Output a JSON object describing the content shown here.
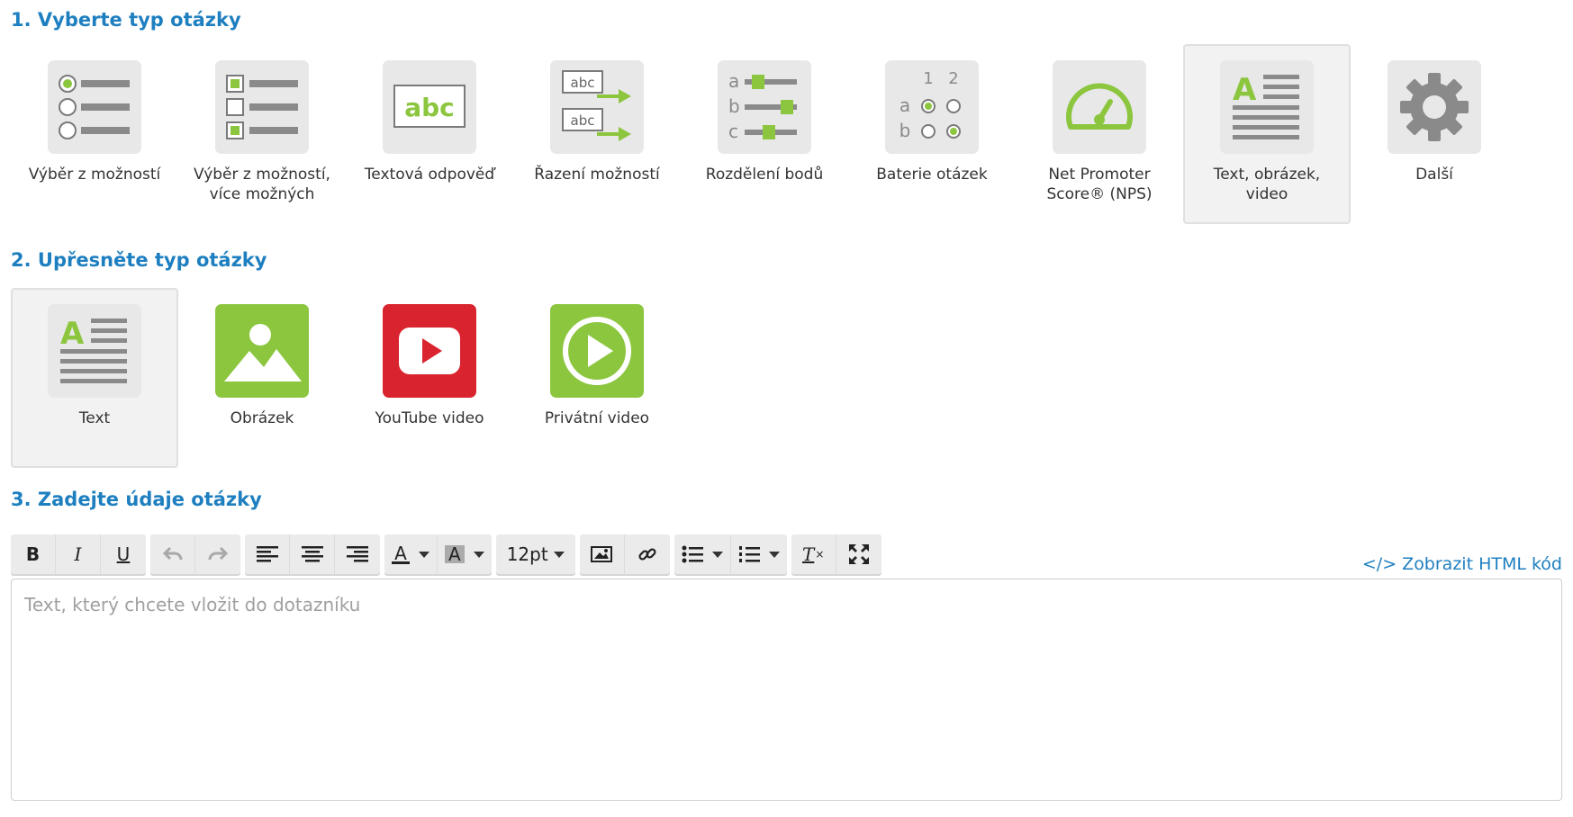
{
  "section1": {
    "title": "1. Vyberte typ otázky",
    "types": [
      {
        "label": "Výběr z možností",
        "icon": "single-choice-icon"
      },
      {
        "label": "Výběr z možností, více možných",
        "icon": "multiple-choice-icon"
      },
      {
        "label": "Textová odpověď",
        "icon": "text-answer-icon"
      },
      {
        "label": "Řazení možností",
        "icon": "ordering-icon"
      },
      {
        "label": "Rozdělení bodů",
        "icon": "points-distribution-icon"
      },
      {
        "label": "Baterie otázek",
        "icon": "question-battery-icon"
      },
      {
        "label": "Net Promoter Score® (NPS)",
        "icon": "nps-gauge-icon"
      },
      {
        "label": "Text, obrázek, video",
        "icon": "text-image-video-icon",
        "selected": true
      },
      {
        "label": "Další",
        "icon": "gear-icon"
      }
    ],
    "icon_text": {
      "abc": "abc",
      "a": "a",
      "b": "b",
      "c": "c",
      "one": "1",
      "two": "2",
      "A": "A"
    }
  },
  "section2": {
    "title": "2. Upřesněte typ otázky",
    "types": [
      {
        "label": "Text",
        "icon": "text-icon",
        "selected": true
      },
      {
        "label": "Obrázek",
        "icon": "image-icon"
      },
      {
        "label": "YouTube video",
        "icon": "youtube-icon"
      },
      {
        "label": "Privátní video",
        "icon": "play-icon"
      }
    ]
  },
  "section3": {
    "title": "3. Zadejte údaje otázky",
    "toolbar": {
      "bold": "B",
      "italic": "I",
      "underline": "U",
      "font_color_glyph": "A",
      "bg_color_glyph": "A",
      "font_size": "12pt",
      "clear_format_glyph": "T"
    },
    "html_link": "</> Zobrazit HTML kód",
    "editor_placeholder": "Text, který chcete vložit do dotazníku"
  },
  "colors": {
    "accent": "#1e7fc0",
    "green": "#8cc63f",
    "youtube_red": "#d9232e",
    "icon_gray": "#7a7a7a",
    "tile_bg": "#e8e8e8"
  }
}
